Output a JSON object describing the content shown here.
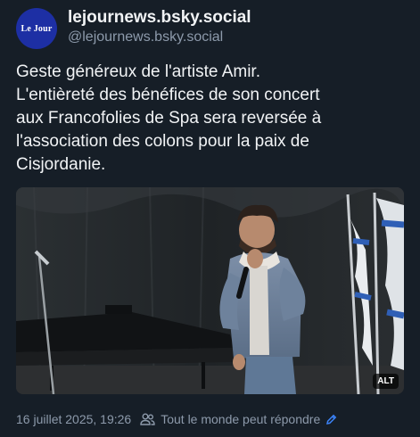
{
  "author": {
    "avatar_text": "Le Jour",
    "display_name": "lejournews.bsky.social",
    "handle": "@lejournews.bsky.social"
  },
  "post": {
    "lines": [
      "Geste généreux de l'artiste Amir.",
      "L'entièreté des bénéfices de son concert",
      "aux Francofolies de Spa sera reversée à",
      "l'association des colons pour la paix de",
      "Cisjordanie."
    ],
    "image_alt_label": "ALT"
  },
  "meta": {
    "timestamp": "16 juillet 2025, 19:26",
    "reply_setting": "Tout le monde peut répondre"
  },
  "colors": {
    "background": "#161e27",
    "avatar": "#1d2fa4",
    "muted_text": "#8d9aab",
    "accent": "#3b82f6"
  },
  "icons": {
    "reply_setting": "people-icon",
    "edit": "pencil-icon"
  }
}
